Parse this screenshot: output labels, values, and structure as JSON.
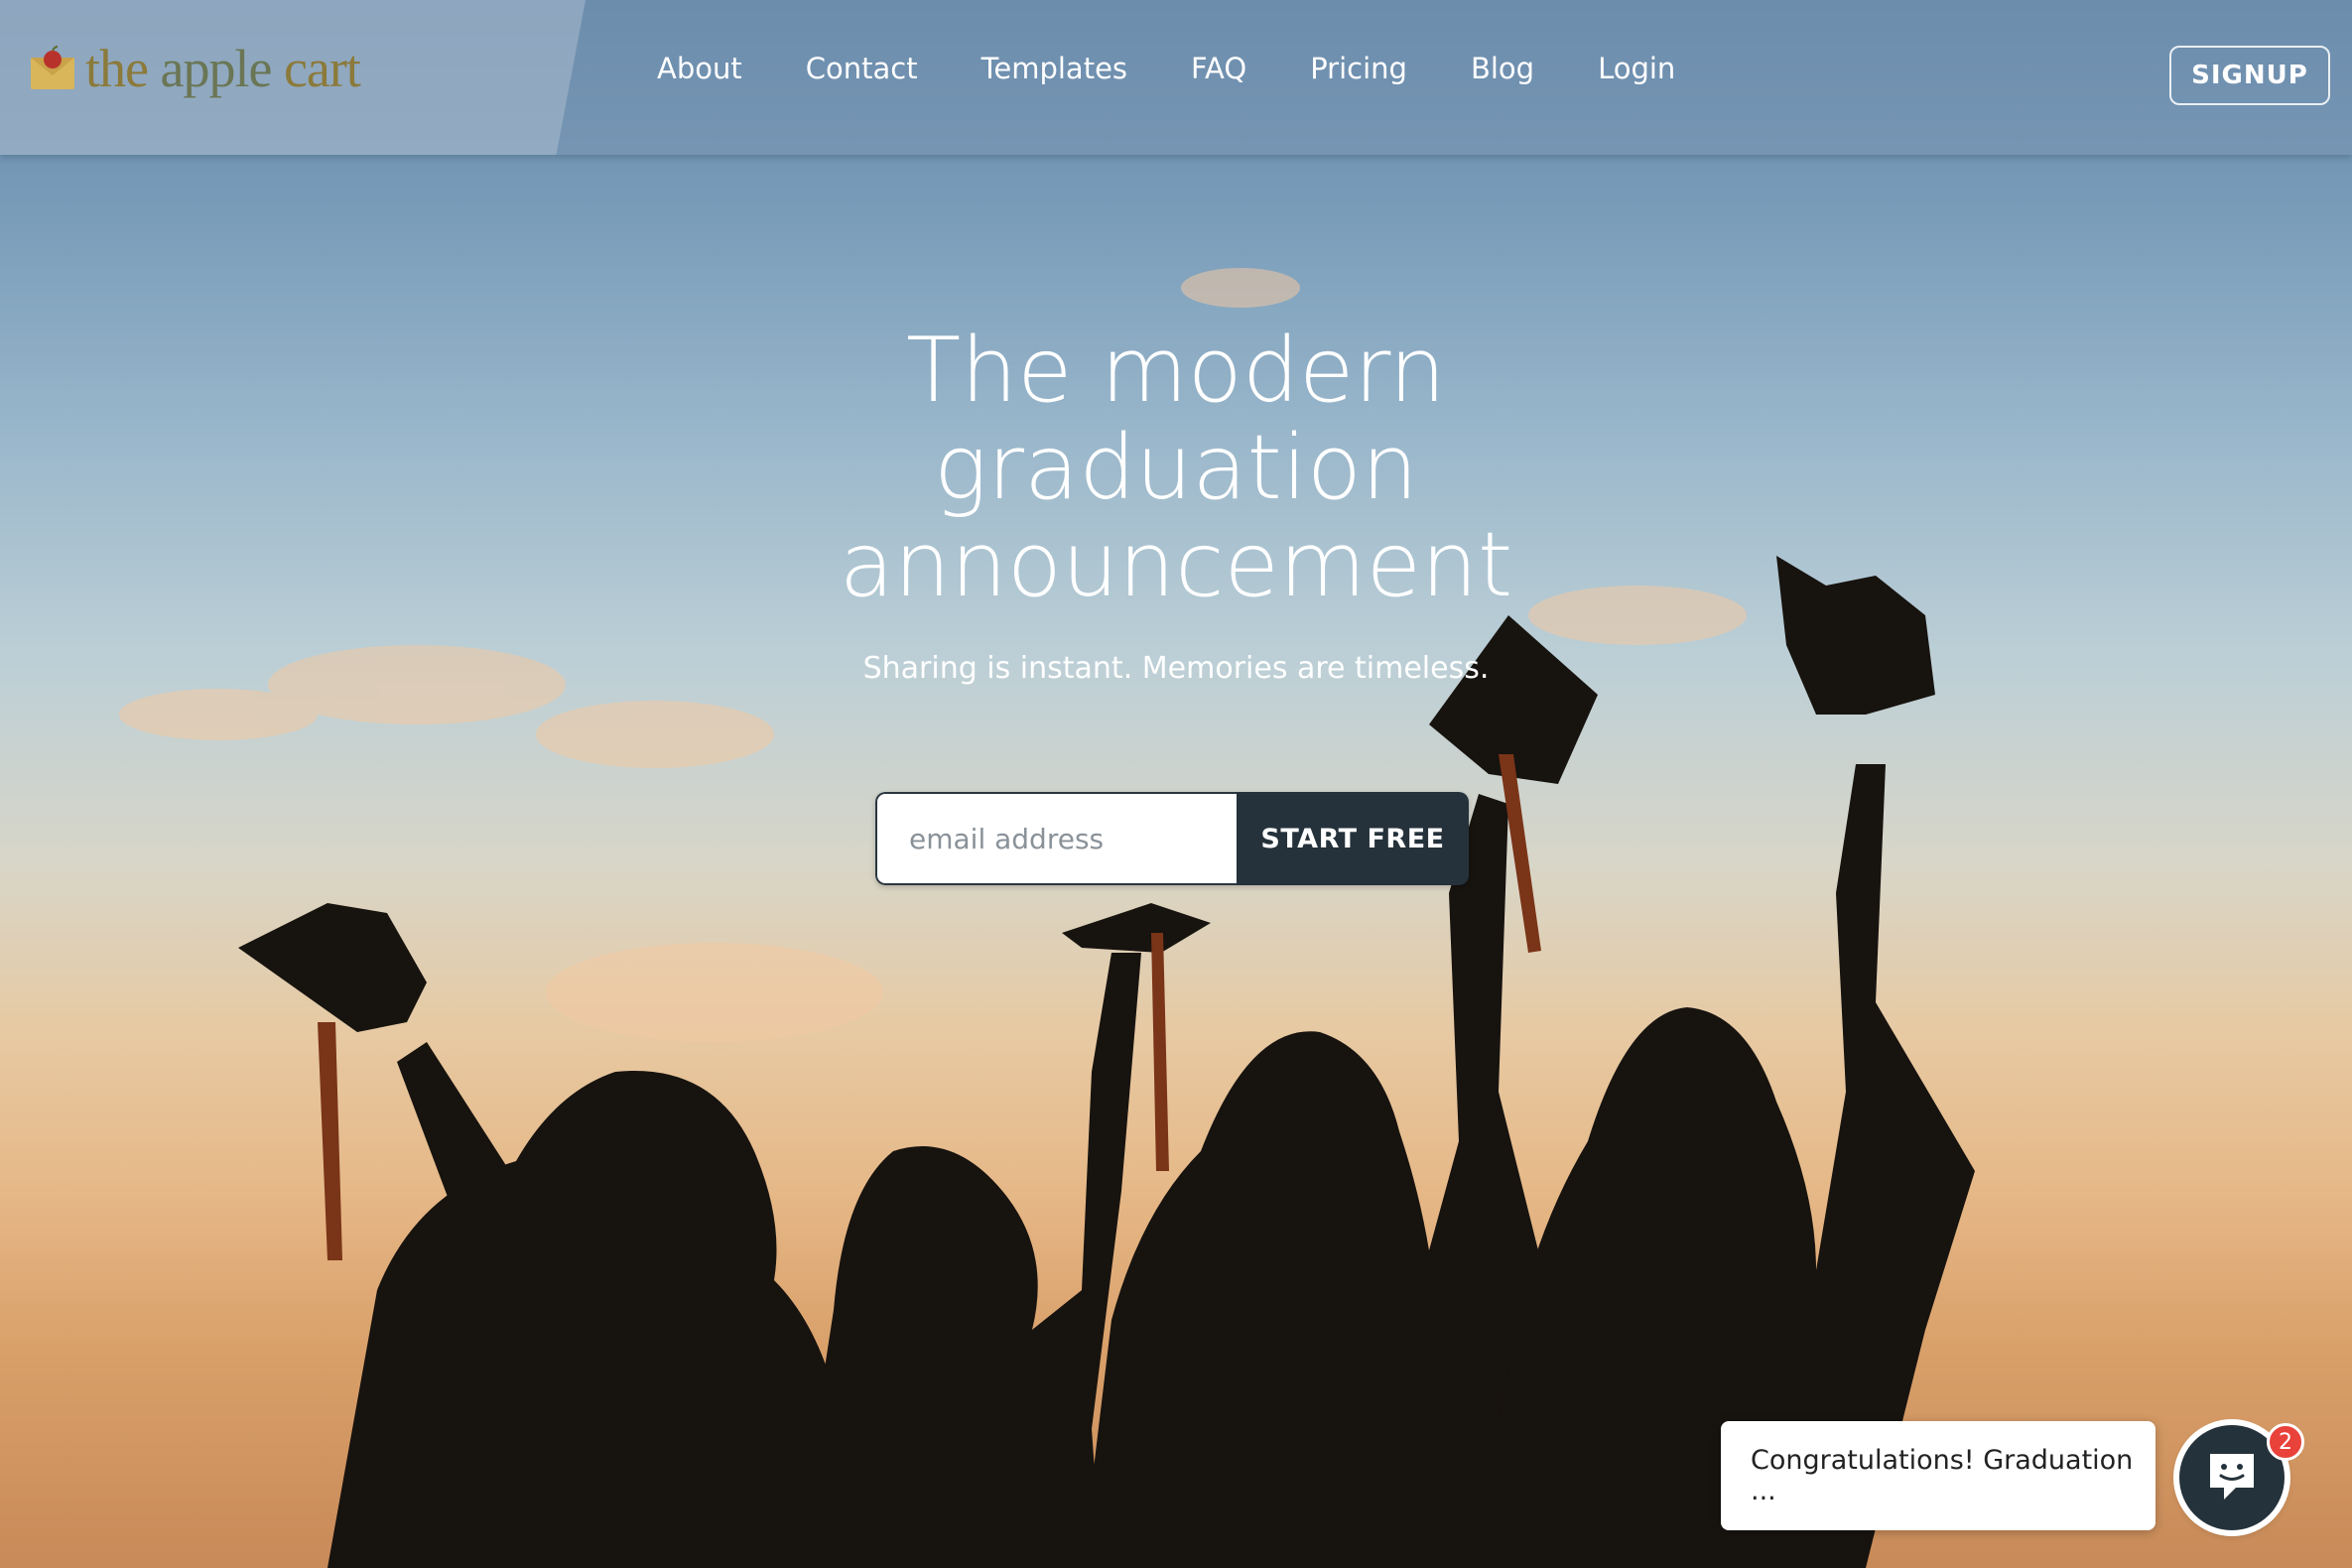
{
  "brand": {
    "logo_part1": "the ",
    "logo_part2": "apple",
    "logo_part3": " cart"
  },
  "nav": {
    "items": [
      "About",
      "Contact",
      "Templates",
      "FAQ",
      "Pricing",
      "Blog",
      "Login"
    ]
  },
  "header": {
    "signup_label": "SIGNUP"
  },
  "hero": {
    "headline_line1": "The modern",
    "headline_line2": "graduation",
    "headline_line3": "announcement",
    "subheading": "Sharing is instant. Memories are timeless.",
    "email_placeholder": "email address",
    "cta_label": "START FREE",
    "background_image": "graduates silhouettes tossing caps at sunset sky"
  },
  "chat": {
    "preview_text": "Congratulations! Graduation ...",
    "unread_count": "2",
    "icon": "chat-face-icon"
  },
  "colors": {
    "dark_navy": "#25323b",
    "badge_red": "#e8423a",
    "logo_gold": "#8b7a3a"
  }
}
